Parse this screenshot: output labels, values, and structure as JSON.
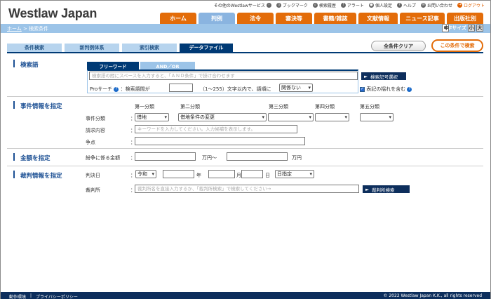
{
  "header": {
    "logo": "Westlaw Japan",
    "toplinks": [
      {
        "label": "その他のWestlawサービス",
        "icon": "arrow-circle-icon"
      },
      {
        "label": "ブックマーク",
        "icon": "bookmark-icon"
      },
      {
        "label": "検索履歴",
        "icon": "history-icon"
      },
      {
        "label": "アラート",
        "icon": "alert-icon"
      },
      {
        "label": "個人設定",
        "icon": "user-settings-icon"
      },
      {
        "label": "ヘルプ",
        "icon": "help-icon"
      },
      {
        "label": "お問い合わせ",
        "icon": "contact-icon"
      },
      {
        "label": "ログアウト",
        "icon": "logout-icon"
      }
    ],
    "nav_tabs": [
      "ホーム",
      "判例",
      "法令",
      "審決等",
      "書籍/雑誌",
      "文献情報",
      "ニュース記事",
      "出版社別"
    ],
    "active_nav": "判例"
  },
  "bluebar": {
    "breadcrumb_home": "ホーム",
    "breadcrumb_sep": " > ",
    "breadcrumb_current": "検索条件",
    "font_size_label": "文字サイズ",
    "font_sizes": [
      "小",
      "中",
      "大"
    ],
    "font_size_selected": "中"
  },
  "search_tabs": [
    "条件検索",
    "新判例体系",
    "索引検索",
    "データファイル"
  ],
  "active_search_tab": "データファイル",
  "buttons": {
    "clear_all": "全条件クリア",
    "search": "この条件で検索"
  },
  "keyword": {
    "title": "検索語",
    "tabs": [
      "フリーワード",
      "AND／OR"
    ],
    "active_tab": "フリーワード",
    "placeholder": "検索語の間にスペースを入力すると、「ＡＮＤ条件」で掛け合わせます",
    "symbol_button": "検索記号選択",
    "pro_label": "Proサーチ",
    "pro_text1": "：検索語間が",
    "pro_value": "",
    "pro_text2": "（1〜255）文字以内で、語順に",
    "order_select": "関係ない",
    "variant_label": "表記の揺れを含む"
  },
  "case_info": {
    "title": "事件情報を指定",
    "class_headers": [
      "第一分類",
      "第二分類",
      "第三分類",
      "第四分類",
      "第五分類"
    ],
    "class_label": "事件分類",
    "class_values": [
      "借地",
      "借地条件の変更",
      "",
      "",
      ""
    ],
    "claim_label": "請求内容",
    "claim_placeholder": "キーワードを入力してください。入力候補を表示します。",
    "issue_label": "争点",
    "issue_value": ""
  },
  "amount": {
    "title": "金額を指定",
    "label": "紛争に係る金額",
    "from_value": "",
    "unit1": "万円〜",
    "to_value": "",
    "unit2": "万円"
  },
  "judgment": {
    "title": "裁判情報を指定",
    "date_label": "判決日",
    "era_select": "令和",
    "year_unit": "年",
    "month_unit": "月",
    "day_unit": "日",
    "date_mode": "日指定",
    "court_label": "裁判所",
    "court_placeholder": "裁判所名を直接入力するか、「裁判所検索」で検索してください→",
    "court_search_button": "裁判所検索"
  },
  "footer": {
    "links": [
      "動作環境",
      "プライバシーポリシー"
    ],
    "separator": "|",
    "copyright": "© 2022 Westlaw Japan K.K., all rights reserved"
  },
  "colors": {
    "accent_orange": "#e36c09",
    "navy": "#003a75",
    "light_blue": "#9cc4e8",
    "section_title": "#1b4f93"
  }
}
